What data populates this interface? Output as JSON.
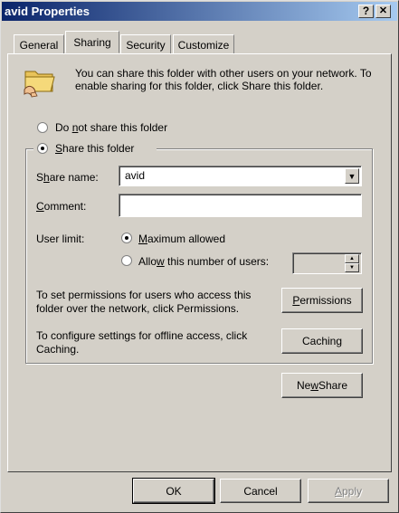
{
  "window": {
    "title": "avid Properties",
    "help_button": "?",
    "close_button": "✕"
  },
  "tabs": [
    "General",
    "Sharing",
    "Security",
    "Customize"
  ],
  "active_tab": "Sharing",
  "sharing": {
    "intro": "You can share this folder with other users on your network.  To enable sharing for this folder, click Share this folder.",
    "folder_icon": "shared-folder-icon",
    "do_not_share": {
      "label_pre": "Do ",
      "label_u": "n",
      "label_post": "ot share this folder",
      "selected": false
    },
    "share_this": {
      "label_u": "S",
      "label_post": "hare this folder",
      "selected": true
    },
    "share_name": {
      "label_pre": "S",
      "label_u": "h",
      "label_post": "are name:",
      "value": "avid"
    },
    "comment": {
      "label_u": "C",
      "label_post": "omment:",
      "value": ""
    },
    "user_limit": {
      "label": "User limit:",
      "maximum": {
        "label_u": "M",
        "label_post": "aximum allowed",
        "selected": true
      },
      "allow": {
        "label_pre": "Allo",
        "label_u": "w",
        "label_post": " this number of users:",
        "selected": false,
        "value": ""
      }
    },
    "permissions": {
      "text": "To set permissions for users who access this folder over the network, click Permissions.",
      "button_u": "P",
      "button_post": "ermissions"
    },
    "caching": {
      "text": "To configure settings for offline access, click Caching.",
      "button": "Caching"
    },
    "new_share": {
      "label_pre": "Ne",
      "label_u": "w",
      "label_post": " Share"
    }
  },
  "footer": {
    "ok": "OK",
    "cancel": "Cancel",
    "apply_u": "A",
    "apply_post": "pply"
  }
}
